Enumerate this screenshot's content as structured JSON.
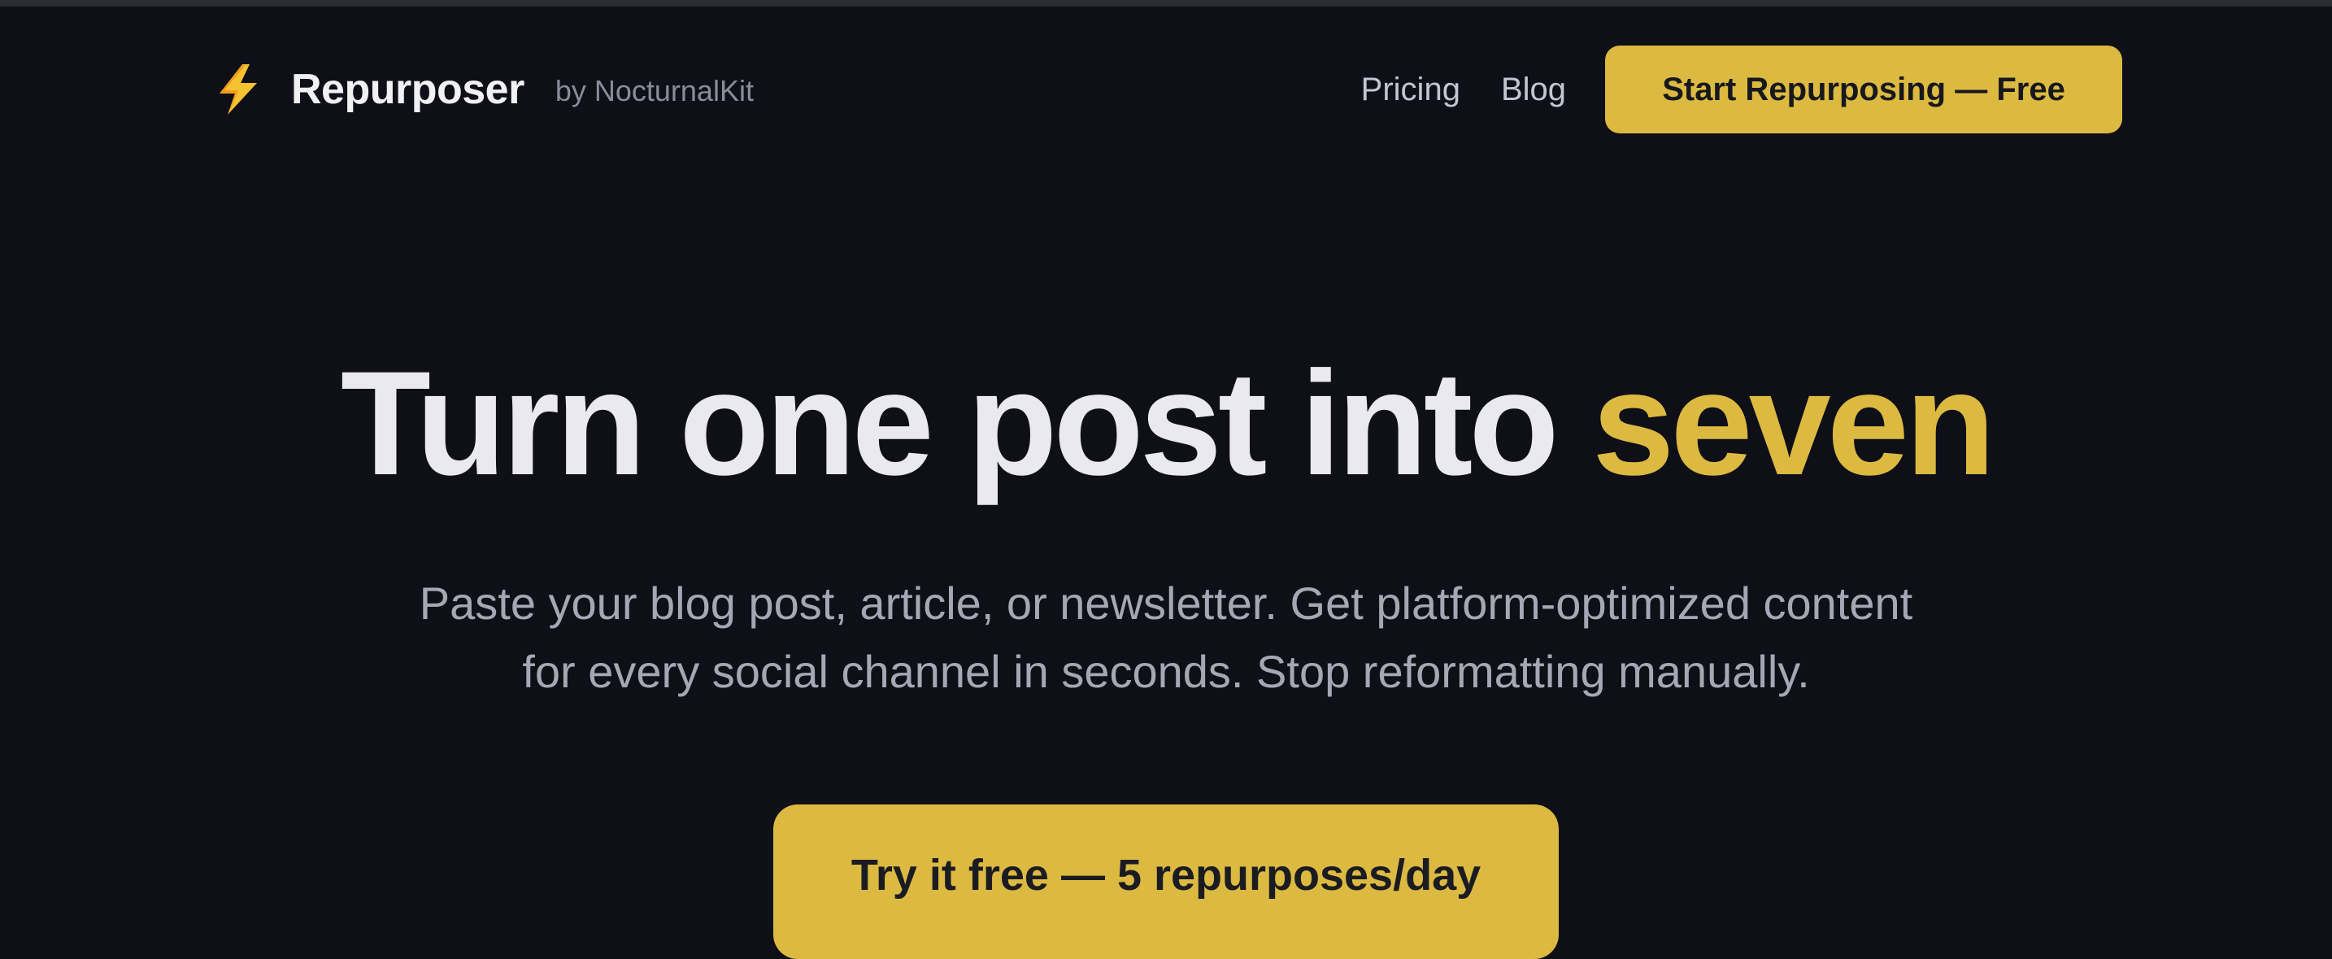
{
  "colors": {
    "background": "#0e0f17",
    "accent": "#dcb941",
    "heading": "#e9e9ef",
    "muted": "#a5a8b4"
  },
  "header": {
    "brand": {
      "icon": "lightning-bolt-icon",
      "name": "Repurposer",
      "byline": "by NocturnalKit"
    },
    "nav": {
      "pricing": "Pricing",
      "blog": "Blog"
    },
    "cta_label": "Start Repurposing — Free"
  },
  "hero": {
    "title_main": "Turn one post into ",
    "title_accent": "seven",
    "subtitle_line1": "Paste your blog post, article, or newsletter. Get platform-optimized content",
    "subtitle_line2": "for every social channel in seconds. Stop reformatting manually.",
    "cta_label": "Try it free — 5 repurposes/day"
  }
}
